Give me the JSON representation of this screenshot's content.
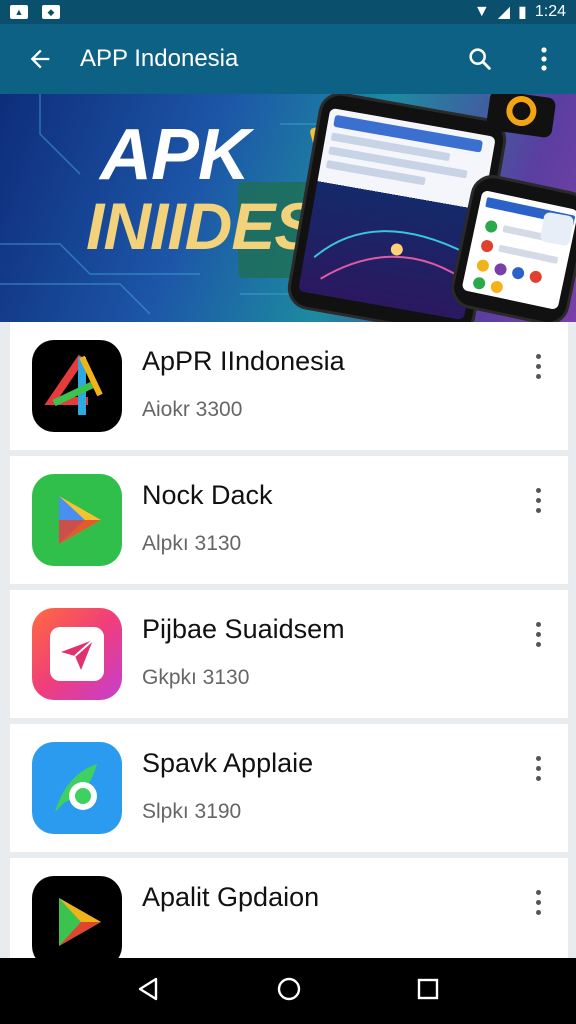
{
  "status": {
    "time": "1:24"
  },
  "header": {
    "title": "APP Indonesia"
  },
  "banner": {
    "line1": "APK",
    "line2": "INIIDESIA"
  },
  "apps": [
    {
      "name": "ApPR IIndonesia",
      "meta": "Aiokr 3300",
      "icon": "stylized-4-icon"
    },
    {
      "name": "Nock Dack",
      "meta": "Alpkı 3130",
      "icon": "play-triangle-icon"
    },
    {
      "name": "Pijbae Suaidsem",
      "meta": "Gkpkı 3130",
      "icon": "paper-plane-icon"
    },
    {
      "name": "Spavk Applaie",
      "meta": "Slpkı 3190",
      "icon": "leaf-bird-icon"
    },
    {
      "name": "Apalit Gpdaion",
      "meta": "",
      "icon": "play-gradient-icon"
    }
  ]
}
